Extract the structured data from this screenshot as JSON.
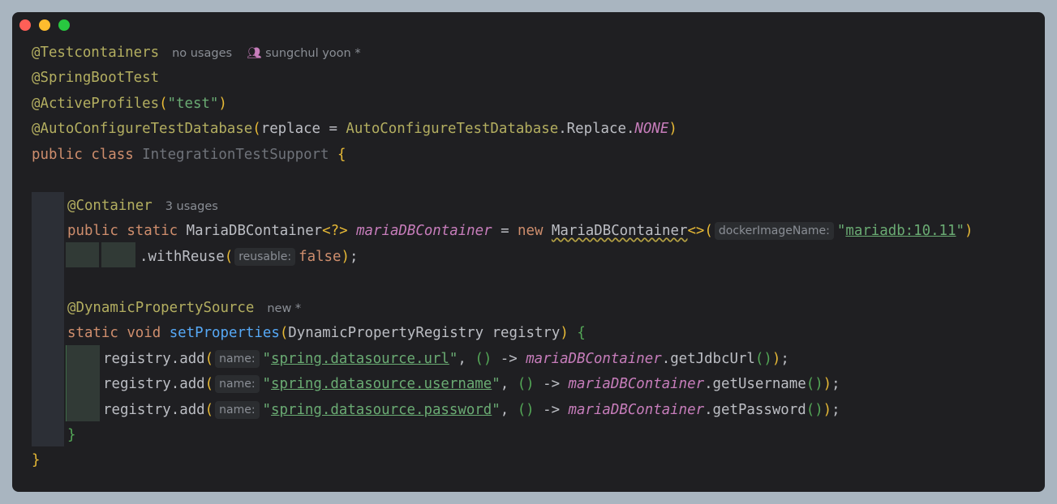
{
  "window": {
    "controls": [
      "close",
      "minimize",
      "maximize"
    ]
  },
  "code": {
    "line1_annotation": "@Testcontainers",
    "line1_usages": "no usages",
    "line1_author_icon": "people-icon",
    "line1_author": "sungchul yoon *",
    "line2": "@SpringBootTest",
    "line3_annotation": "@ActiveProfiles",
    "line3_arg": "\"test\"",
    "line4_annotation": "@AutoConfigureTestDatabase",
    "line4_param": "replace = ",
    "line4_class": "AutoConfigureTestDatabase",
    "line4_member": ".Replace.",
    "line4_enum": "NONE",
    "line5_kw1": "public",
    "line5_kw2": "class",
    "line5_class": "IntegrationTestSupport",
    "line6_annotation": "@Container",
    "line6_usages": "3 usages",
    "line7_kw1": "public",
    "line7_kw2": "static",
    "line7_type": "MariaDBContainer",
    "line7_generic": "<?>",
    "line7_field": "mariaDBContainer",
    "line7_eq": " = ",
    "line7_new": "new",
    "line7_ctor": "MariaDBContainer",
    "line7_diamond": "<>",
    "line7_hint": "dockerImageName:",
    "line7_arg": "mariadb:10.11",
    "line8_call": ".withReuse",
    "line8_hint": "reusable:",
    "line8_arg": "false",
    "line9_annotation": "@DynamicPropertySource",
    "line9_status": "new *",
    "line10_kw1": "static",
    "line10_kw2": "void",
    "line10_method": "setProperties",
    "line10_params": "DynamicPropertyRegistry registry",
    "reg_call": "registry.add",
    "reg_hint": "name:",
    "reg_arrow": " -> ",
    "reg_field": "mariaDBContainer",
    "line11_key": "spring.datasource.url",
    "line11_getter": ".getJdbcUrl",
    "line12_key": "spring.datasource.username",
    "line12_getter": ".getUsername",
    "line13_key": "spring.datasource.password",
    "line13_getter": ".getPassword",
    "close_inner": "}",
    "close_outer": "}"
  },
  "colors": {
    "background": "#a9b5c0",
    "editor": "#1f1f22",
    "annotation": "#b3ae60",
    "keyword": "#cf8e6d",
    "string": "#6aab73",
    "field": "#c77dbb",
    "method": "#56a8f5"
  }
}
